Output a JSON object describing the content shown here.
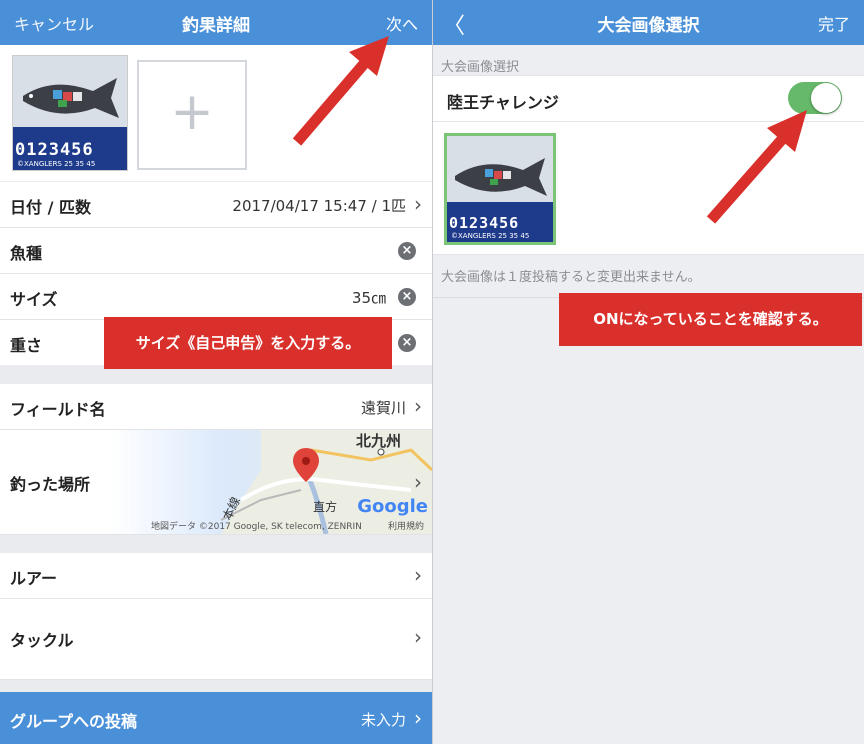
{
  "left": {
    "navbar": {
      "cancel": "キャンセル",
      "title": "釣果詳細",
      "next": "次へ"
    },
    "photo": {
      "ruler_numbers": "0123456",
      "ruler_small": "©XANGLERS  25  35  45"
    },
    "rows": {
      "date_label": "日付 / 匹数",
      "date_value": "2017/04/17 15:47 / 1匹",
      "species_label": "魚種",
      "size_label": "サイズ",
      "size_value": "35㎝",
      "weight_label": "重さ",
      "field_label": "フィールド名",
      "field_value": "遠賀川",
      "place_label": "釣った場所",
      "lure_label": "ルアー",
      "tackle_label": "タックル"
    },
    "map": {
      "city1": "北九州",
      "city2": "直方",
      "rail": "本線",
      "google": "Google",
      "copyright": "地図データ ©2017 Google, SK telecom, ZENRIN",
      "terms": "利用規約"
    },
    "bottom": {
      "label": "グループへの投稿",
      "value": "未入力"
    },
    "annotation": "サイズ《自己申告》を入力する。"
  },
  "right": {
    "navbar": {
      "back": "〈",
      "title": "大会画像選択",
      "done": "完了"
    },
    "section_header": "大会画像選択",
    "toggle_label": "陸王チャレンジ",
    "toggle_on": true,
    "note": "大会画像は１度投稿すると変更出来ません。",
    "annotation": "ONになっていることを確認する。"
  },
  "colors": {
    "navbar": "#4a90d9",
    "annotation": "#d9302b",
    "toggle_on": "#66b96a",
    "selected_border": "#7cc576"
  }
}
